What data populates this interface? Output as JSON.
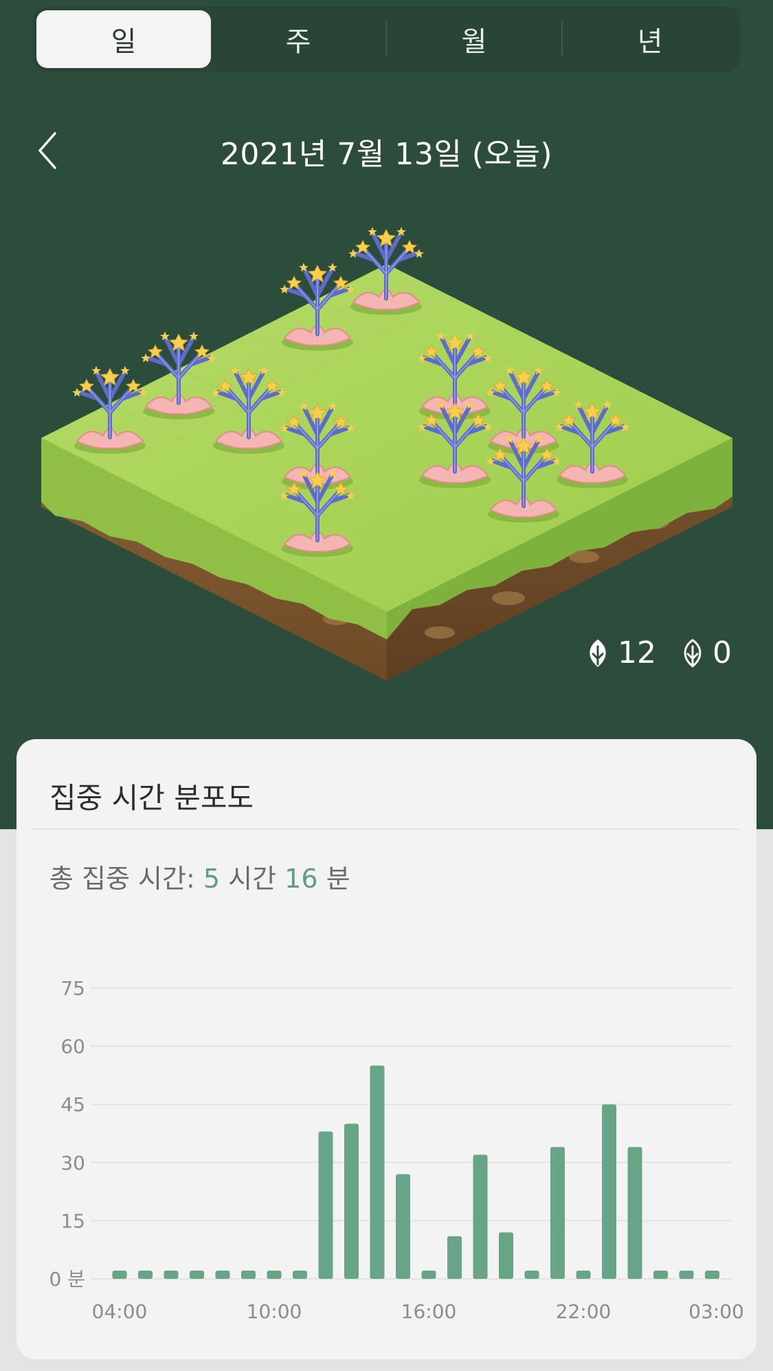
{
  "tabs": [
    {
      "label": "일",
      "active": true
    },
    {
      "label": "주",
      "active": false
    },
    {
      "label": "월",
      "active": false
    },
    {
      "label": "년",
      "active": false
    }
  ],
  "date_title": "2021년 7월 13일 (오늘)",
  "counts": {
    "healthy": "12",
    "withered": "0"
  },
  "card": {
    "title": "집중 시간 분포도",
    "total_prefix": "총 집중 시간:",
    "hours": "5",
    "hours_unit": "시간",
    "minutes": "16",
    "minutes_unit": "분"
  },
  "colors": {
    "background": "#2c4d3c",
    "accent": "#68a486",
    "card": "#f3f3f3"
  },
  "chart_data": {
    "type": "bar",
    "ylim": [
      0,
      75
    ],
    "yticks": [
      0,
      15,
      30,
      45,
      60,
      75
    ],
    "ytick_labels": [
      "0 분",
      "15",
      "30",
      "45",
      "60",
      "75"
    ],
    "xtick_labels": [
      "04:00",
      "10:00",
      "16:00",
      "22:00",
      "03:00"
    ],
    "categories": [
      "04:00",
      "05:00",
      "06:00",
      "07:00",
      "08:00",
      "09:00",
      "10:00",
      "11:00",
      "12:00",
      "13:00",
      "14:00",
      "15:00",
      "16:00",
      "17:00",
      "18:00",
      "19:00",
      "20:00",
      "21:00",
      "22:00",
      "23:00",
      "00:00",
      "01:00",
      "02:00",
      "03:00"
    ],
    "values": [
      0,
      0,
      0,
      0,
      0,
      0,
      0,
      0,
      38,
      40,
      55,
      27,
      0,
      11,
      32,
      12,
      0,
      34,
      0,
      45,
      34,
      0,
      0,
      0
    ],
    "grid": true
  }
}
